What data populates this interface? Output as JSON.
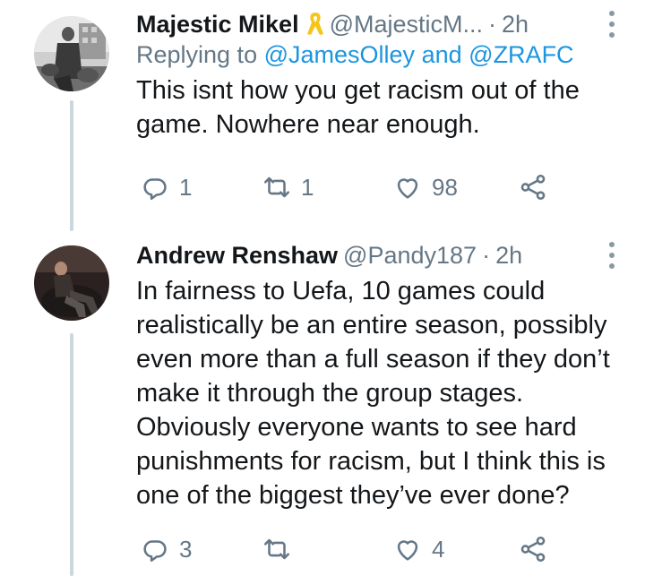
{
  "tweets": [
    {
      "name": "Majestic Mikel",
      "handle": "@MajesticM...",
      "separator": "·",
      "time": "2h",
      "replying_prefix": "Replying to",
      "replying_user1": "@JamesOlley",
      "replying_and": "and",
      "replying_user2": "@ZRAFC",
      "text": "This isnt how you get racism out of the game. Nowhere near enough.",
      "replies": "1",
      "retweets": "1",
      "likes": "98",
      "badge_icon": "yellow-ribbon-icon"
    },
    {
      "name": "Andrew Renshaw",
      "handle": "@Pandy187",
      "separator": "·",
      "time": "2h",
      "text": "In fairness to Uefa, 10 games could realistically be an entire season, possibly even more than a full season if they don’t make it through the group stages. Obviously everyone wants to see hard punishments for racism, but I think this is one of the biggest they’ve ever done?",
      "replies": "3",
      "retweets": "",
      "likes": "4"
    }
  ],
  "colors": {
    "text": "#14171a",
    "secondary": "#657786",
    "link": "#1b95e0",
    "thread_line": "#ccd6dd",
    "ribbon": "#f5c518"
  },
  "icons": [
    "reply-icon",
    "retweet-icon",
    "like-icon",
    "share-icon",
    "more-icon"
  ]
}
